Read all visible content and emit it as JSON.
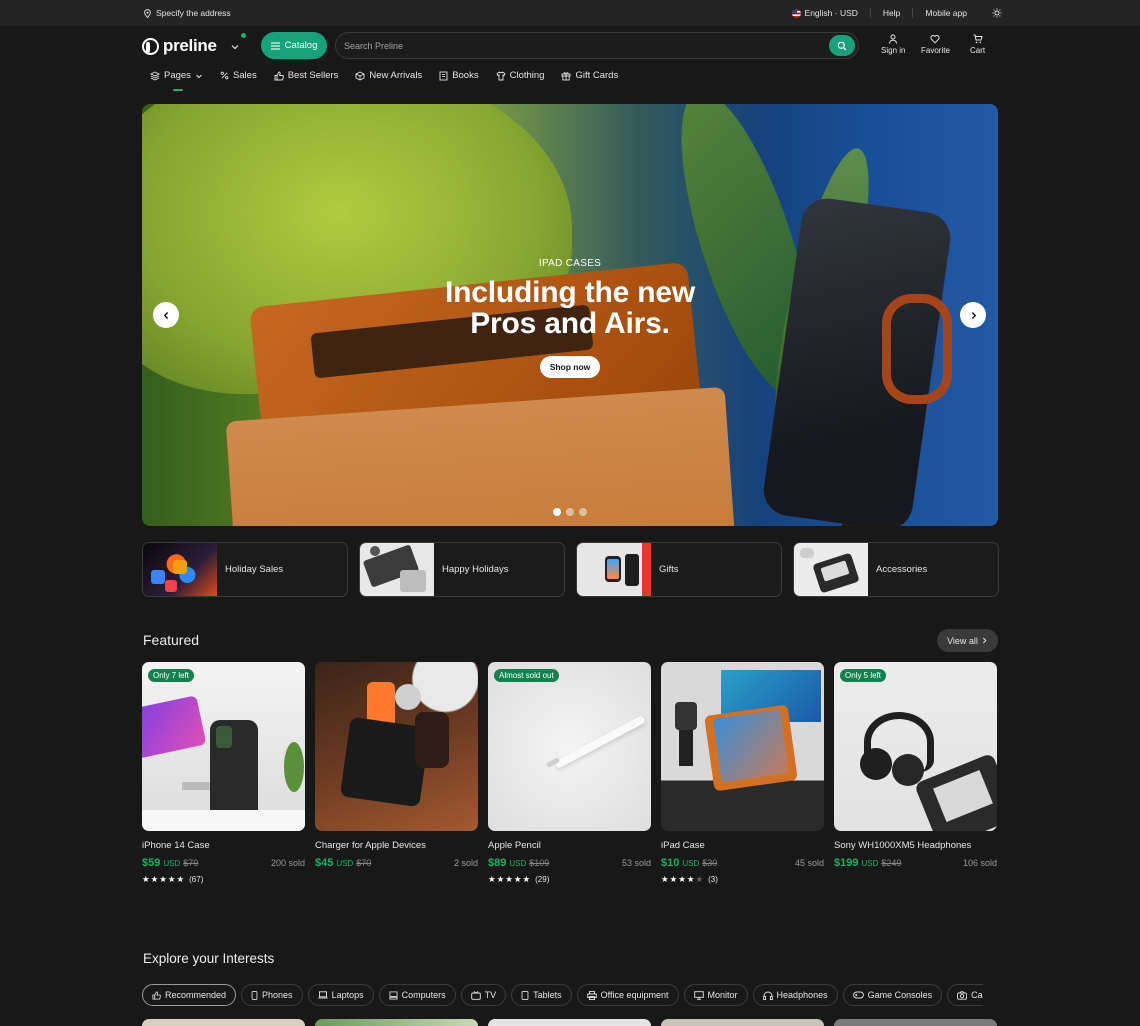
{
  "topbar": {
    "address": "Specify the address",
    "language": "English · USD",
    "help": "Help",
    "mobile_app": "Mobile app"
  },
  "header": {
    "logo": "preline",
    "catalog": "Catalog",
    "search_placeholder": "Search Preline",
    "sign_in": "Sign in",
    "favorite": "Favorite",
    "cart": "Cart"
  },
  "nav": [
    {
      "label": "Pages",
      "icon": "layers-icon"
    },
    {
      "label": "Sales",
      "icon": "percent-icon"
    },
    {
      "label": "Best Sellers",
      "icon": "thumbs-up-icon"
    },
    {
      "label": "New Arrivals",
      "icon": "box-icon"
    },
    {
      "label": "Books",
      "icon": "book-icon"
    },
    {
      "label": "Clothing",
      "icon": "shirt-icon"
    },
    {
      "label": "Gift Cards",
      "icon": "gift-icon"
    }
  ],
  "hero": {
    "eyebrow": "IPAD CASES",
    "title_line1": "Including the new",
    "title_line2": "Pros and Airs.",
    "cta": "Shop now",
    "active_slide": 1,
    "slide_count": 3
  },
  "categories": [
    {
      "label": "Holiday Sales"
    },
    {
      "label": "Happy Holidays"
    },
    {
      "label": "Gifts"
    },
    {
      "label": "Accessories"
    }
  ],
  "featured": {
    "title": "Featured",
    "view_all": "View all",
    "products": [
      {
        "badge": "Only 7 left",
        "name": "iPhone 14 Case",
        "price": "$59",
        "currency": "USD",
        "old_price": "$79",
        "sold": "200 sold",
        "rating": 5,
        "reviews": "(67)"
      },
      {
        "badge": "",
        "name": "Charger for Apple Devices",
        "price": "$45",
        "currency": "USD",
        "old_price": "$70",
        "sold": "2 sold",
        "rating": 0,
        "reviews": ""
      },
      {
        "badge": "Almost sold out",
        "name": "Apple Pencil",
        "price": "$89",
        "currency": "USD",
        "old_price": "$109",
        "sold": "53 sold",
        "rating": 5,
        "reviews": "(29)"
      },
      {
        "badge": "",
        "name": "iPad Case",
        "price": "$10",
        "currency": "USD",
        "old_price": "$30",
        "sold": "45 sold",
        "rating": 4,
        "reviews": "(3)"
      },
      {
        "badge": "Only 5 left",
        "name": "Sony WH1000XM5 Headphones",
        "price": "$199",
        "currency": "USD",
        "old_price": "$249",
        "sold": "106 sold",
        "rating": 0,
        "reviews": ""
      }
    ]
  },
  "interests": {
    "title": "Explore your Interests",
    "chips": [
      "Recommended",
      "Phones",
      "Laptops",
      "Computers",
      "TV",
      "Tablets",
      "Office equipment",
      "Monitor",
      "Headphones",
      "Game Consoles",
      "Cameras"
    ]
  },
  "colors": {
    "accent": "#16a37a",
    "price": "#17b26a",
    "background": "#181818",
    "topbar": "#242424"
  }
}
